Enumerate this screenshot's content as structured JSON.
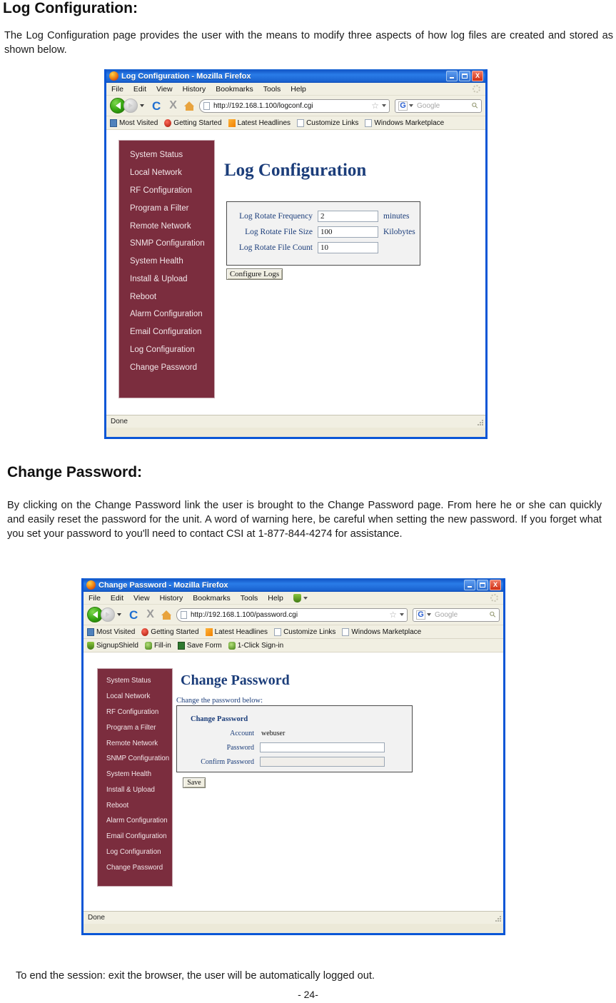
{
  "document": {
    "section1": {
      "heading": "Log Configuration:",
      "paragraph": "The Log Configuration page provides the user with the means to modify three aspects of how log files are created and stored as shown below."
    },
    "section2": {
      "heading": "Change Password:",
      "paragraph": "By clicking on the Change Password link the user is brought to the Change Password page.  From here he or she can quickly and easily reset the password for the unit.  A word of warning here, be careful when setting the new password. If you forget what you set your password to you'll need to contact CSI at 1-877-844-4274 for assistance."
    },
    "footer_note": "To end the session: exit  the browser, the user will be automatically logged out.",
    "page_number": "- 24-"
  },
  "colors": {
    "sidebar_maroon": "#7b2d3e",
    "heading_blue": "#1b3d7a",
    "titlebar_blue": "#1558c8",
    "window_border": "#0a56d6",
    "chrome_beige": "#f1efe2"
  },
  "browser_chrome": {
    "menu_items": [
      "File",
      "Edit",
      "View",
      "History",
      "Bookmarks",
      "Tools",
      "Help"
    ],
    "window_buttons": {
      "minimize": "minimize-button",
      "maximize": "maximize-button",
      "close": "X"
    },
    "nav_icons": {
      "back": "back-arrow-icon",
      "forward": "forward-arrow-icon",
      "dropdown": "history-dropdown-icon",
      "reload": "C",
      "stop": "X",
      "home": "home-icon"
    },
    "search": {
      "engine_glyph": "G",
      "placeholder": "Google"
    },
    "bookmarks": [
      {
        "label": "Most Visited",
        "icon": "most-visited-icon"
      },
      {
        "label": "Getting Started",
        "icon": "getting-started-icon"
      },
      {
        "label": "Latest Headlines",
        "icon": "rss-icon"
      },
      {
        "label": "Customize Links",
        "icon": "page-icon"
      },
      {
        "label": "Windows Marketplace",
        "icon": "page-icon"
      }
    ],
    "status_text": "Done"
  },
  "app_nav_items": [
    "System Status",
    "Local Network",
    "RF Configuration",
    "Program a Filter",
    "Remote Network",
    "SNMP Configuration",
    "System Health",
    "Install & Upload",
    "Reboot",
    "Alarm Configuration",
    "Email Configuration",
    "Log Configuration",
    "Change Password"
  ],
  "window1": {
    "title": "Log Configuration - Mozilla Firefox",
    "url": "http://192.168.1.100/logconf.cgi",
    "page_heading": "Log Configuration",
    "fields": [
      {
        "label": "Log Rotate Frequency",
        "value": "2",
        "unit": "minutes"
      },
      {
        "label": "Log Rotate File Size",
        "value": "100",
        "unit": "Kilobytes"
      },
      {
        "label": "Log Rotate File Count",
        "value": "10",
        "unit": ""
      }
    ],
    "submit_label": "Configure Logs"
  },
  "window2": {
    "title": "Change Password - Mozilla Firefox",
    "url": "http://192.168.1.100/password.cgi",
    "extra_toolbar": [
      {
        "label": "SignupShield",
        "icon": "shield-icon"
      },
      {
        "label": "Fill-in",
        "icon": "fill-in-icon"
      },
      {
        "label": "Save Form",
        "icon": "save-form-icon"
      },
      {
        "label": "1-Click Sign-in",
        "icon": "one-click-signin-icon"
      }
    ],
    "page_heading": "Change Password",
    "instruction": "Change the password below:",
    "panel_heading": "Change Password",
    "fields": [
      {
        "label": "Account",
        "value": "webuser",
        "type": "static"
      },
      {
        "label": "Password",
        "value": "",
        "type": "input"
      },
      {
        "label": "Confirm Password",
        "value": "",
        "type": "input-shaded"
      }
    ],
    "submit_label": "Save"
  }
}
